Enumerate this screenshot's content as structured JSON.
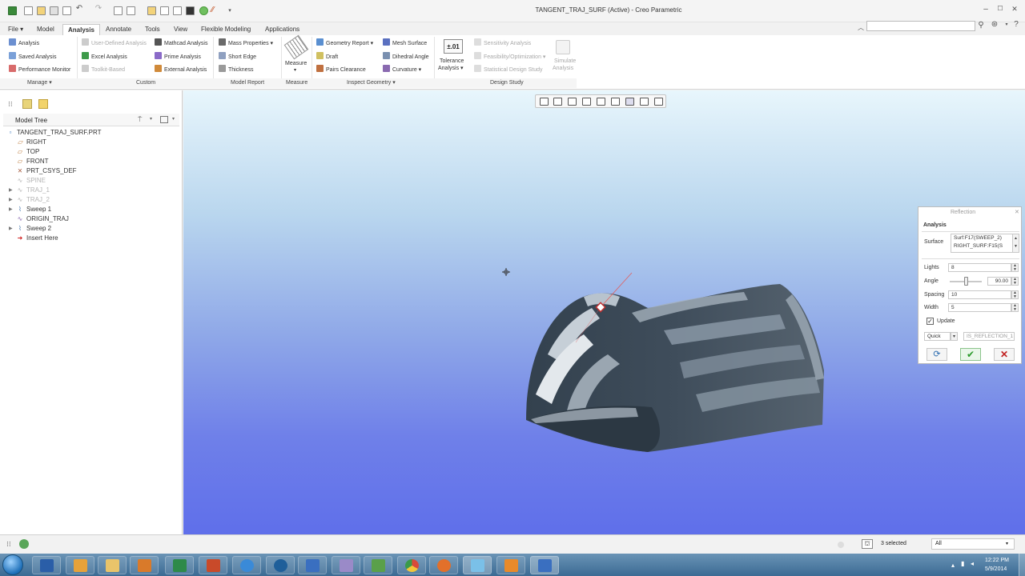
{
  "window": {
    "title": "TANGENT_TRAJ_SURF (Active) - Creo Parametric"
  },
  "tabs": [
    {
      "label": "File"
    },
    {
      "label": "Model"
    },
    {
      "label": "Analysis"
    },
    {
      "label": "Annotate"
    },
    {
      "label": "Tools"
    },
    {
      "label": "View"
    },
    {
      "label": "Flexible Modeling"
    },
    {
      "label": "Applications"
    }
  ],
  "ribbon": {
    "manage": {
      "analysis": "Analysis",
      "saved": "Saved Analysis",
      "perf": "Performance Monitor"
    },
    "custom": {
      "uda": "User-Defined Analysis",
      "excel": "Excel Analysis",
      "toolkit": "Toolkit-Based",
      "mathcad": "Mathcad Analysis",
      "prime": "Prime Analysis",
      "external": "External Analysis"
    },
    "model_report": {
      "mass": "Mass Properties",
      "short_edge": "Short Edge",
      "thickness": "Thickness"
    },
    "measure": {
      "label": "Measure"
    },
    "inspect": {
      "geom_report": "Geometry Report",
      "draft": "Draft",
      "pairs": "Pairs Clearance",
      "mesh": "Mesh Surface",
      "dihedral": "Dihedral Angle",
      "curvature": "Curvature"
    },
    "tolerance": {
      "icon_text": "±.01",
      "label1": "Tolerance",
      "label2": "Analysis"
    },
    "design_study": {
      "sensitivity": "Sensitivity Analysis",
      "feasibility": "Feasibility/Optimization",
      "statistical": "Statistical Design Study",
      "sim1": "Simulate",
      "sim2": "Analysis"
    },
    "groups": {
      "manage": "Manage",
      "custom": "Custom",
      "model_report": "Model Report",
      "measure": "Measure",
      "inspect": "Inspect Geometry",
      "design_study": "Design Study"
    }
  },
  "model_tree": {
    "header": "Model Tree",
    "items": [
      {
        "label": "TANGENT_TRAJ_SURF.PRT",
        "icon": "part-icon"
      },
      {
        "label": "RIGHT",
        "icon": "datum-plane-icon"
      },
      {
        "label": "TOP",
        "icon": "datum-plane-icon"
      },
      {
        "label": "FRONT",
        "icon": "datum-plane-icon"
      },
      {
        "label": "PRT_CSYS_DEF",
        "icon": "csys-icon"
      },
      {
        "label": "SPINE",
        "icon": "sketch-icon"
      },
      {
        "label": "TRAJ_1",
        "icon": "sketch-icon"
      },
      {
        "label": "TRAJ_2",
        "icon": "sketch-icon"
      },
      {
        "label": "Sweep 1",
        "icon": "sweep-icon"
      },
      {
        "label": "ORIGIN_TRAJ",
        "icon": "sketch-icon"
      },
      {
        "label": "Sweep 2",
        "icon": "sweep-icon"
      },
      {
        "label": "Insert Here",
        "icon": "insert-arrow-icon"
      }
    ]
  },
  "dialog": {
    "title": "Reflection",
    "tab": "Analysis",
    "surface_label": "Surface",
    "surface_values": [
      "Surf:F17(SWEEP_2)",
      "RIGHT_SURF:F15(S"
    ],
    "lights_label": "Lights",
    "lights_value": "8",
    "angle_label": "Angle",
    "angle_value": "90.00",
    "angle_slider_fraction": 0.5,
    "spacing_label": "Spacing",
    "spacing_value": "10",
    "width_label": "Width",
    "width_value": "5",
    "update_label": "Update",
    "update_checked": true,
    "mode_value": "Quick",
    "name_value": "IS_REFLECTION_1"
  },
  "status": {
    "selected": "3 selected",
    "filter": "All"
  },
  "taskbar": {
    "time": "12:22 PM",
    "date": "5/9/2014"
  },
  "colors": {
    "accent": "#2b6cb0",
    "surface": "#3d4a57",
    "bg_top": "#e8f6fc",
    "bg_bottom": "#5f6fea"
  }
}
